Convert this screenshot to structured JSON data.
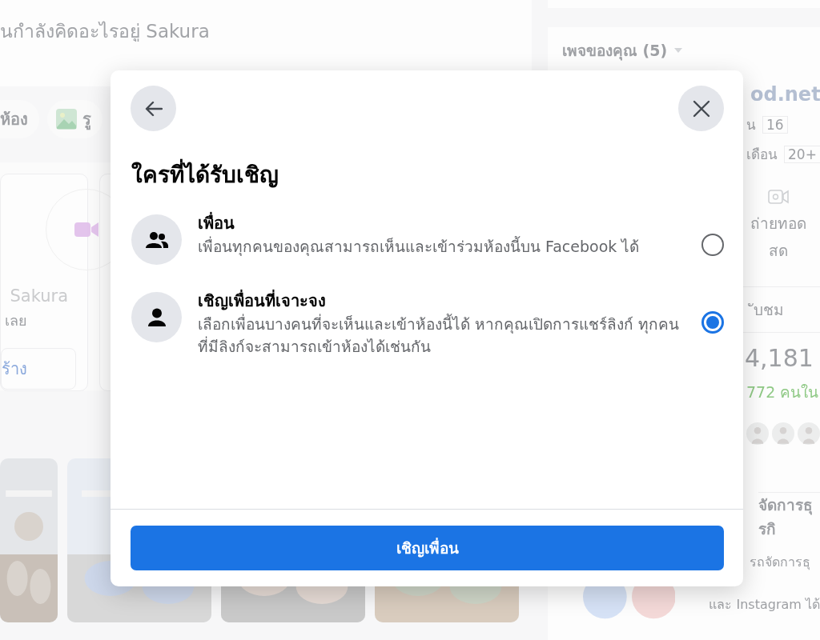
{
  "background": {
    "composer": {
      "placeholder": "นกำลังคิดอะไรอยู่ Sakura"
    },
    "composer_actions": [
      "ห้อง",
      "รู"
    ],
    "room_card": {
      "name": "Sakura",
      "subtitle": "เลย",
      "button": "ร้าง"
    },
    "pages_panel": {
      "title": "เพจของคุณ (5)",
      "page_name": "od.net",
      "stats": [
        {
          "label": "น",
          "value": "16"
        },
        {
          "label": "เดือน",
          "value": "20+"
        }
      ],
      "action": "ถ่ายทอดสด",
      "tab": "ับชม",
      "count": "4,181",
      "count_note": "772 คนใน",
      "section_title": "จัดการธุรกิ",
      "section_lines": [
        "รถจัดการธุ",
        "และ Instagram ได้"
      ]
    }
  },
  "dialog": {
    "title": "ใครที่ได้รับเชิญ",
    "options": [
      {
        "kind": "group",
        "title": "เพื่อน",
        "description": "เพื่อนทุกคนของคุณสามารถเห็นและเข้าร่วมห้องนี้บน Facebook ได้",
        "selected": false
      },
      {
        "kind": "person",
        "title": "เชิญเพื่อนที่เจาะจง",
        "description": "เลือกเพื่อนบางคนที่จะเห็นและเข้าห้องนี้ได้ หากคุณเปิดการแชร์ลิงก์ ทุกคนที่มีลิงก์จะสามารถเข้าห้องได้เช่นกัน",
        "selected": true
      }
    ],
    "button": "เชิญเพื่อน"
  }
}
